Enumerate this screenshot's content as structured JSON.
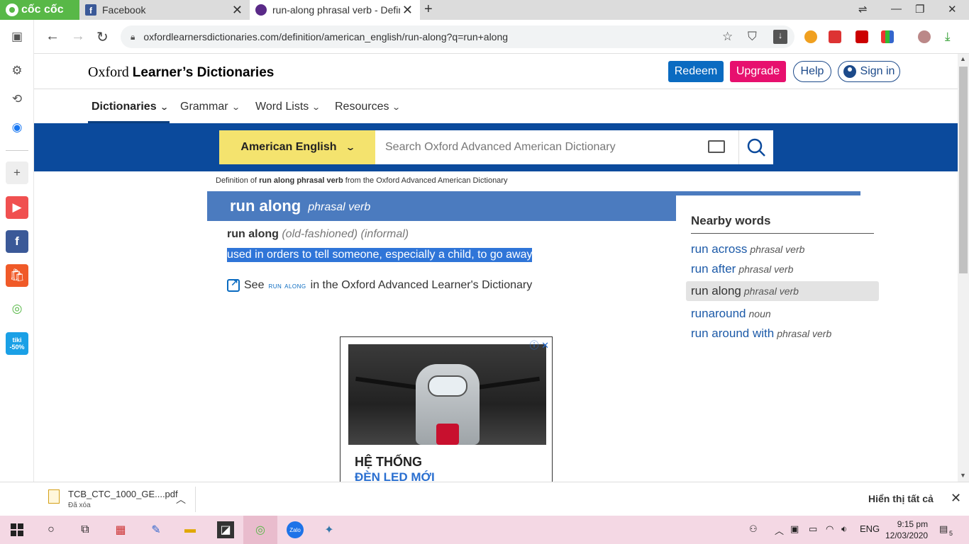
{
  "browser": {
    "brand": "cốc cốc",
    "tabs": [
      {
        "title": "Facebook"
      },
      {
        "title": "run-along phrasal verb - Definition"
      }
    ],
    "url": "oxfordlearnersdictionaries.com/definition/american_english/run-along?q=run+along"
  },
  "site": {
    "logo_regular": "Oxford ",
    "logo_bold": "Learner’s Dictionaries",
    "buttons": {
      "redeem": "Redeem",
      "upgrade": "Upgrade",
      "help": "Help",
      "signin": "Sign in"
    },
    "nav": [
      "Dictionaries",
      "Grammar",
      "Word Lists",
      "Resources"
    ],
    "search": {
      "dictionary": "American English",
      "placeholder": "Search Oxford Advanced American Dictionary"
    }
  },
  "entry": {
    "breadcrumb_pre": "Definition of ",
    "breadcrumb_bold": "run along phrasal verb",
    "breadcrumb_post": " from the Oxford Advanced American Dictionary",
    "headword": "run along",
    "pos": "phrasal verb",
    "phrase": "run along",
    "labels": [
      "(old-fashioned)",
      "(informal)"
    ],
    "definition": "used in orders to tell someone, especially a child, to go away",
    "see_pre": "See",
    "see_link": "run along",
    "see_post": "in the Oxford Advanced Learner's Dictionary"
  },
  "nearby": {
    "title": "Nearby words",
    "items": [
      {
        "word": "run across",
        "pos": "phrasal verb"
      },
      {
        "word": "run after",
        "pos": "phrasal verb"
      },
      {
        "word": "run along",
        "pos": "phrasal verb",
        "selected": true
      },
      {
        "word": "runaround",
        "pos": "noun"
      },
      {
        "word": "run around with",
        "pos": "phrasal verb"
      }
    ]
  },
  "ad": {
    "line1": "HỆ THỐNG",
    "line2": "ĐÈN LED MỚI"
  },
  "downloads": {
    "file": "TCB_CTC_1000_GE....pdf",
    "status": "Đã xóa",
    "show_all": "Hiển thị tất cả"
  },
  "taskbar": {
    "lang": "ENG",
    "time": "9:15 pm",
    "date": "12/03/2020",
    "notif_count": "5"
  },
  "colors": {
    "brand_blue": "#0b4a9c",
    "entry_blue": "#4b7bbf",
    "dropdown_yellow": "#f4e36e",
    "upgrade_pink": "#e7106e",
    "redeem_blue": "#0a6bc1",
    "coccoc_green": "#58b847"
  }
}
